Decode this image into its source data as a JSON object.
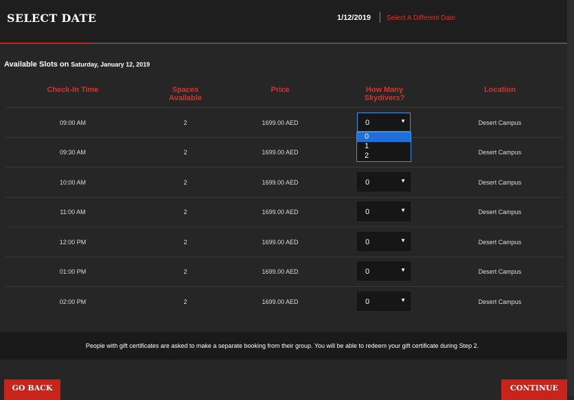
{
  "header": {
    "title": "SELECT DATE",
    "date": "1/12/2019",
    "change_link": "Select A Different Date"
  },
  "available": {
    "prefix": "Available Slots on",
    "date": "Saturday, January 12, 2019"
  },
  "columns": {
    "checkin": "Check-In Time",
    "spaces_1": "Spaces",
    "spaces_2": "Available",
    "price": "Price",
    "skydivers_1": "How Many",
    "skydivers_2": "Skydivers?",
    "location": "Location"
  },
  "rows": [
    {
      "time": "09:00 AM",
      "spaces": "2",
      "price": "1699.00 AED",
      "count": "0",
      "location": "Desert Campus"
    },
    {
      "time": "09:30 AM",
      "spaces": "2",
      "price": "1699.00 AED",
      "count": "0",
      "location": "Desert Campus"
    },
    {
      "time": "10:00 AM",
      "spaces": "2",
      "price": "1699.00 AED",
      "count": "0",
      "location": "Desert Campus"
    },
    {
      "time": "11:00 AM",
      "spaces": "2",
      "price": "1699.00 AED",
      "count": "0",
      "location": "Desert Campus"
    },
    {
      "time": "12:00 PM",
      "spaces": "2",
      "price": "1699.00 AED",
      "count": "0",
      "location": "Desert Campus"
    },
    {
      "time": "01:00 PM",
      "spaces": "2",
      "price": "1699.00 AED",
      "count": "0",
      "location": "Desert Campus"
    },
    {
      "time": "02:00 PM",
      "spaces": "2",
      "price": "1699.00 AED",
      "count": "0",
      "location": "Desert Campus"
    }
  ],
  "dropdown": {
    "options": [
      "0",
      "1",
      "2"
    ],
    "selected": "0"
  },
  "arrow_glyph": "▼",
  "notice": "People with gift certificates are asked to make a separate booking from their group. You will be able to redeem your gift certificate during Step 2.",
  "buttons": {
    "back": "GO BACK",
    "continue": "CONTINUE"
  },
  "colors": {
    "accent": "#c8241c",
    "header_text_red": "#d6332b",
    "background": "#262626"
  }
}
